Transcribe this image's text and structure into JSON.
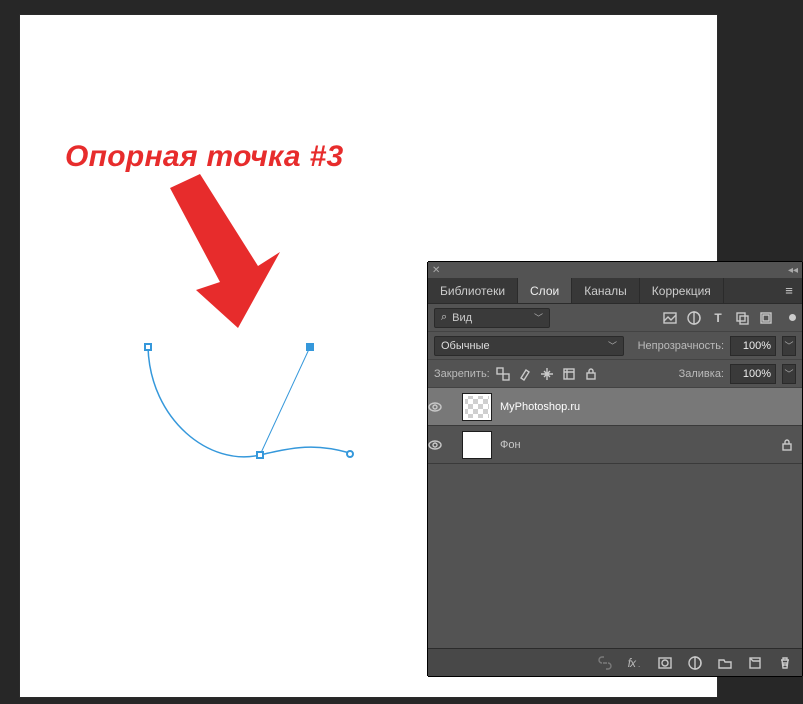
{
  "annotation": {
    "text": "Опорная точка #3"
  },
  "colors": {
    "annotation": "#e72c2c",
    "path": "#3598db"
  },
  "panel": {
    "tabs": [
      "Библиотеки",
      "Слои",
      "Каналы",
      "Коррекция"
    ],
    "activeTab": 1,
    "search": {
      "icon": "⌕",
      "label": "Вид"
    },
    "filterIcons": [
      "image-icon",
      "adjust-icon",
      "type-icon",
      "shape-icon",
      "smart-icon"
    ],
    "blendMode": "Обычные",
    "opacityLabel": "Непрозрачность:",
    "opacityValue": "100%",
    "lockLabel": "Закрепить:",
    "fillLabel": "Заливка:",
    "fillValue": "100%",
    "layers": [
      {
        "name": "MyPhotoshop.ru",
        "visible": true,
        "selected": true,
        "thumb": "checker",
        "locked": false
      },
      {
        "name": "Фон",
        "visible": true,
        "selected": false,
        "thumb": "white",
        "locked": true
      }
    ],
    "bottomIcons": [
      "link-icon",
      "fx-icon",
      "mask-icon",
      "adjustment-icon",
      "group-icon",
      "new-icon",
      "trash-icon"
    ]
  }
}
